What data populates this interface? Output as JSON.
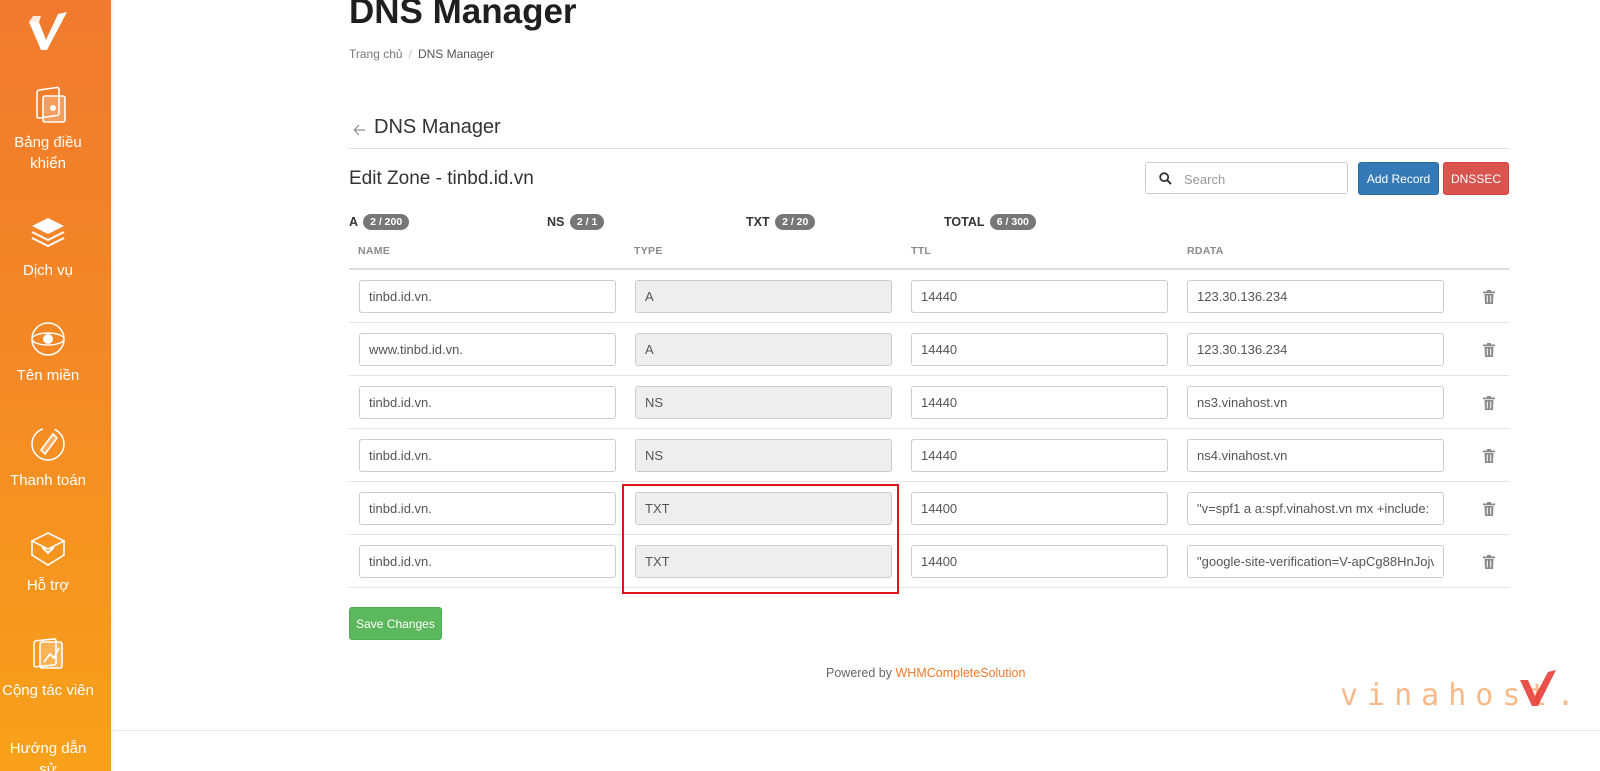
{
  "sidebar": {
    "items": [
      {
        "label": "Bảng điều khiển",
        "icon": "dashboard-icon"
      },
      {
        "label": "Dịch vụ",
        "icon": "services-icon"
      },
      {
        "label": "Tên miền",
        "icon": "domain-icon"
      },
      {
        "label": "Thanh toán",
        "icon": "billing-icon"
      },
      {
        "label": "Hỗ trợ",
        "icon": "support-icon"
      },
      {
        "label": "Cộng tác viên",
        "icon": "affiliate-icon"
      },
      {
        "label": "Hướng dẫn sử",
        "icon": "guide-icon"
      }
    ],
    "color_top": "#f07a2e",
    "color_bottom": "#f9a11a"
  },
  "page": {
    "title": "DNS Manager",
    "breadcrumb": [
      "Trang chủ",
      "DNS Manager"
    ]
  },
  "section": {
    "back_icon": "arrow-left-icon",
    "title": "DNS Manager"
  },
  "zone": {
    "title": "Edit Zone - tinbd.id.vn",
    "search_placeholder": "Search",
    "add_record_label": "Add Record",
    "dnssec_label": "DNSSEC"
  },
  "counts": [
    {
      "label": "A",
      "value": "2 / 200"
    },
    {
      "label": "NS",
      "value": "2 / 1"
    },
    {
      "label": "TXT",
      "value": "2 / 20"
    },
    {
      "label": "TOTAL",
      "value": "6 / 300"
    }
  ],
  "table": {
    "headers": [
      "NAME",
      "TYPE",
      "TTL",
      "RDATA"
    ],
    "rows": [
      {
        "name": "tinbd.id.vn.",
        "type": "A",
        "ttl": "14440",
        "rdata": "123.30.136.234"
      },
      {
        "name": "www.tinbd.id.vn.",
        "type": "A",
        "ttl": "14440",
        "rdata": "123.30.136.234"
      },
      {
        "name": "tinbd.id.vn.",
        "type": "NS",
        "ttl": "14440",
        "rdata": "ns3.vinahost.vn"
      },
      {
        "name": "tinbd.id.vn.",
        "type": "NS",
        "ttl": "14440",
        "rdata": "ns4.vinahost.vn"
      },
      {
        "name": "tinbd.id.vn.",
        "type": "TXT",
        "ttl": "14400",
        "rdata": "\"v=spf1 a a:spf.vinahost.vn mx +include:"
      },
      {
        "name": "tinbd.id.vn.",
        "type": "TXT",
        "ttl": "14400",
        "rdata": "\"google-site-verification=V-apCg88HnJojv"
      }
    ]
  },
  "save_label": "Save Changes",
  "footer": {
    "powered_by": "Powered by",
    "brand_link": "WHMCompleteSolution"
  },
  "watermark": "vinahost.",
  "colors": {
    "primary": "#337ab7",
    "danger": "#d9534f",
    "success": "#5cb85c",
    "brand_orange": "#f07a2e",
    "highlight": "#e0121a"
  }
}
